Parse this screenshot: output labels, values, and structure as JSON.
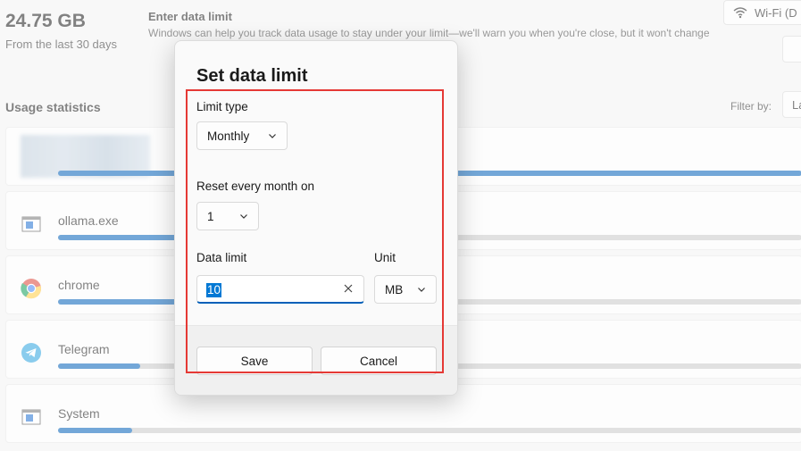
{
  "background": {
    "total_usage": "24.75 GB",
    "total_period": "From the last 30 days",
    "enter_limit_title": "Enter data limit",
    "enter_limit_desc": "Windows can help you track data usage to stay under your limit—we'll warn you when you're close, but it won't change",
    "network_label": "Wi-Fi (D",
    "usage_title": "Usage statistics",
    "filter_label": "Filter by:",
    "filter_value": "La",
    "apps": [
      {
        "name": "",
        "icon": "blurred-app-icon",
        "usage_fraction": 1.0
      },
      {
        "name": "ollama.exe",
        "icon": "system-app-icon",
        "usage_fraction": 0.35
      },
      {
        "name": "chrome",
        "icon": "chrome-icon",
        "usage_fraction": 0.28
      },
      {
        "name": "Telegram",
        "icon": "telegram-icon",
        "usage_fraction": 0.11
      },
      {
        "name": "System",
        "icon": "system-app-icon",
        "usage_fraction": 0.1
      }
    ]
  },
  "dialog": {
    "title": "Set data limit",
    "limit_type_label": "Limit type",
    "limit_type_value": "Monthly",
    "reset_label": "Reset every month on",
    "reset_value": "1",
    "data_limit_label": "Data limit",
    "data_limit_value": "10",
    "unit_label": "Unit",
    "unit_value": "MB",
    "save_label": "Save",
    "cancel_label": "Cancel"
  },
  "colors": {
    "accent": "#005fb8",
    "highlight_box": "#e53935",
    "selection": "#0078d4"
  }
}
